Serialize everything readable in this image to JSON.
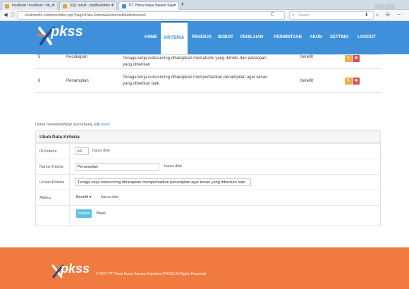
{
  "browser": {
    "tabs": [
      {
        "label": "localhost / localhost / db_sf"
      },
      {
        "label": "SQL result - phpMyAdmin 4"
      },
      {
        "label": "PT Prima Karya Sarana Sejat"
      }
    ],
    "url": "localhost/fe-sufemon/index.php?page=Data Kriteria&action=edit&idkriteria=k6",
    "search_placeholder": "Search"
  },
  "app": {
    "logo_text": "pkss",
    "menu": [
      "HOME",
      "KRITERIA",
      "PEKERJA",
      "BOBOT",
      "PENILAIAN",
      "PERMINTAAN",
      "AKUN",
      "SETTING",
      "LOGOUT"
    ],
    "active_menu": "KRITERIA"
  },
  "criteria_table": {
    "rows": [
      {
        "no": "5",
        "name": "Kecakapan",
        "description": "Tenaga kerja outsourcing diharapkan memahami yang dimiliki dan pekerjaan yang diberikan",
        "type": "benefit"
      },
      {
        "no": "6",
        "name": "Penampilan",
        "description": "Tenaga kerja outsourcing diharapkan memperhatikan penampilan agar kesan yang diberikan baik",
        "type": "benefit"
      }
    ]
  },
  "hint": {
    "text": "Untuk menambahkan sub kriteria, klik",
    "link": "disini"
  },
  "form": {
    "title": "Ubah Data Kriteria",
    "id_label": "ID Kriteria",
    "id_value": "k6",
    "name_label": "Nama Kriteria",
    "name_value": "Penampilan",
    "desc_label": "Uraian Kriteria",
    "desc_value": "Tenaga kerja outsourcing diharapkan memperhatikan penampilan agar kesan yang diberikan baik",
    "attr_label": "Atribut",
    "attr_value": "Benefit",
    "required_text": "harus diisi",
    "save_label": "Simpan",
    "cancel_label": "Batal"
  },
  "footer": {
    "logo_text": "pkss",
    "copyright": "© 2017 PT Prima Karya Sarana Sejahtera (PKSS) All Rights Reserved"
  },
  "colors": {
    "header_blue": "#3f90db",
    "footer_orange": "#f07a3f",
    "edit_orange": "#f0ad4e",
    "delete_red": "#d9534f",
    "save_cyan": "#5bc0de"
  }
}
